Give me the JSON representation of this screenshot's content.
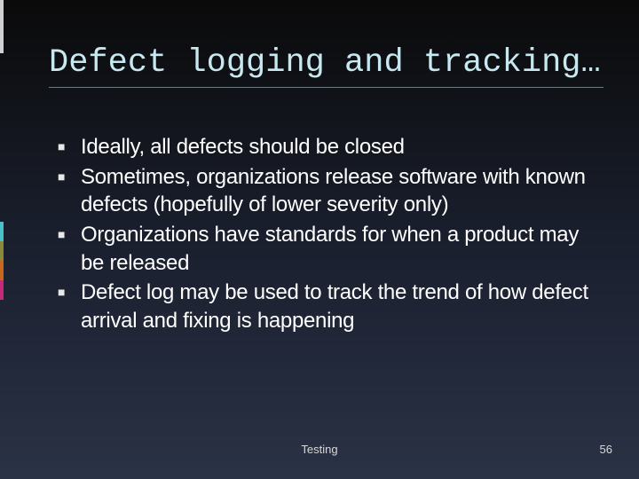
{
  "title": "Defect logging and tracking…",
  "bullets": [
    "Ideally, all defects should be closed",
    "Sometimes, organizations release software with known defects (hopefully of lower severity only)",
    "Organizations have standards for when a product may be released",
    "Defect log may be used to track the trend of how defect arrival and fixing is happening"
  ],
  "footer": "Testing",
  "page_number": "56"
}
